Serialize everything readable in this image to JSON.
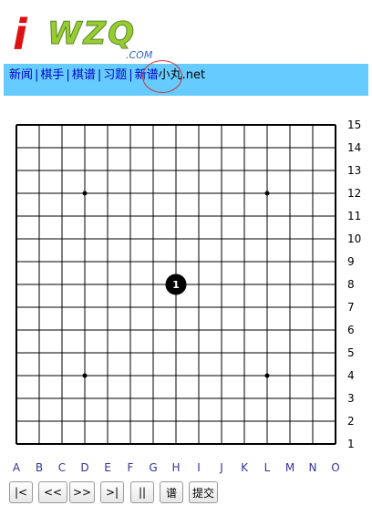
{
  "logo": {
    "text": "iWZQ",
    "subtext": ".COM"
  },
  "nav": {
    "links": [
      "新闻",
      "棋手",
      "棋谱",
      "习题",
      "新谱"
    ],
    "separator": "|",
    "suffix": "小丸.net"
  },
  "board": {
    "size": 15,
    "col_labels": [
      "A",
      "B",
      "C",
      "D",
      "E",
      "F",
      "G",
      "H",
      "I",
      "J",
      "K",
      "L",
      "M",
      "N",
      "O"
    ],
    "row_labels": [
      "15",
      "14",
      "13",
      "12",
      "11",
      "10",
      "9",
      "8",
      "7",
      "6",
      "5",
      "4",
      "3",
      "2",
      "1"
    ],
    "star_points": [
      "D12",
      "L12",
      "D4",
      "L4",
      "H8"
    ],
    "stones": [
      {
        "move": "1",
        "color": "black",
        "col": "H",
        "row": 8
      }
    ],
    "label_color": "#000000",
    "col_label_color": "#333399",
    "line_color": "#000000"
  },
  "controls": {
    "first": "|<",
    "back": "<<",
    "forward": ">>",
    "last": ">|",
    "pause": "||",
    "record": "谱",
    "submit": "提交"
  }
}
